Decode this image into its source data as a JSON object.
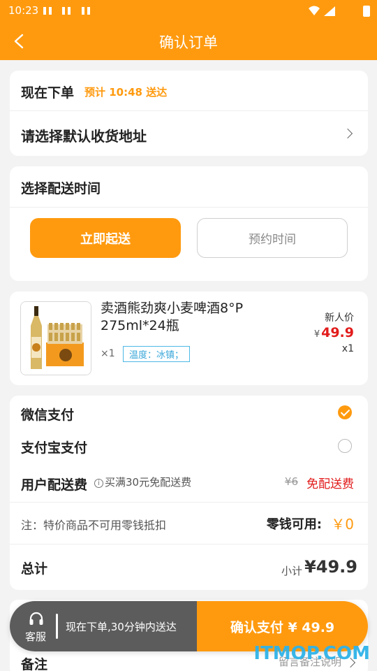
{
  "status_bar": {
    "time": "10:23"
  },
  "header": {
    "title": "确认订单"
  },
  "order_time": {
    "label": "现在下单",
    "eta": "预计 10:48 送达"
  },
  "address": {
    "label": "请选择默认收货地址"
  },
  "delivery": {
    "title": "选择配送时间",
    "primary_option": "立即起送",
    "secondary_option": "预约时间"
  },
  "product": {
    "name": "卖酒熊劲爽小麦啤酒8°P 275ml*24瓶",
    "qty": "×1",
    "tag_label": "温度：",
    "tag_value": "冰镇；",
    "price_label": "新人价",
    "currency": "¥",
    "price": "49.9",
    "count": "x1"
  },
  "payment": {
    "wechat": "微信支付",
    "wechat_selected": true,
    "alipay": "支付宝支付",
    "alipay_selected": false,
    "fee_label": "用户配送费",
    "fee_hint": "买满30元免配送费",
    "fee_original": "¥6",
    "fee_free": "免配送费",
    "note": "注：特价商品不可用零钱抵扣",
    "change_label": "零钱可用:",
    "change_value": "￥0",
    "total_label": "总计",
    "subtotal_label": "小计",
    "subtotal_value": "¥49.9"
  },
  "remark": {
    "label": "备注",
    "hint": "留言备注说明"
  },
  "bottom_bar": {
    "service_label": "客服",
    "message": "现在下单,30分钟内送达",
    "confirm_button": "确认支付 ¥ 49.9"
  },
  "watermark": "ITMOP.COM",
  "colors": {
    "accent": "#ff9a0f",
    "price_red": "#e21b1b",
    "tag_blue": "#3aa7d9",
    "bar_gray": "#5c5c5c"
  }
}
